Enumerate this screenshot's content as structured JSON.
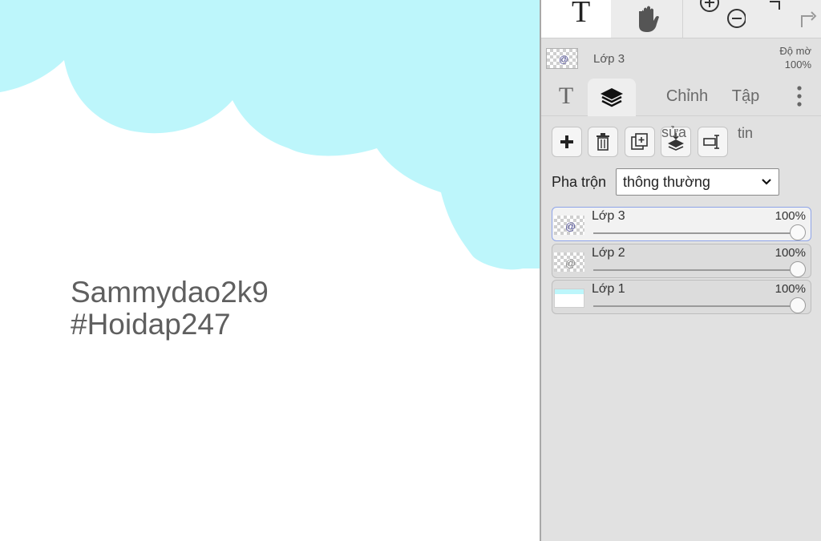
{
  "canvas": {
    "text_line1": "Sammydao2k9",
    "text_line2": "#Hoidap247",
    "cloud_color": "#bdf6fb",
    "text_color": "#5f5f5f"
  },
  "toolbar": {
    "tools": [
      {
        "name": "text-tool",
        "icon": "text-T-icon"
      },
      {
        "name": "hand-tool",
        "icon": "hand-icon"
      },
      {
        "name": "zoom-tool",
        "icon": "zoom-in-out-icon"
      },
      {
        "name": "undo-redo",
        "icon": "redo-icon"
      }
    ]
  },
  "layer_header": {
    "name": "Lớp 3",
    "opacity_label": "Độ mờ",
    "opacity_value": "100%"
  },
  "tabs": {
    "text_icon": "T",
    "layers_icon": "layers-icon",
    "adjust": "Chỉnh",
    "collection": "Tập",
    "more_icon": "more-vertical-icon"
  },
  "actions": {
    "overflow_left": "sửa",
    "overflow_right": "tin",
    "buttons": [
      "add-icon",
      "trash-icon",
      "duplicate-icon",
      "merge-down-icon",
      "rename-icon"
    ]
  },
  "blend": {
    "label": "Pha trộn",
    "value": "thông thường"
  },
  "layers": [
    {
      "name": "Lớp 3",
      "opacity": "100%",
      "active": true
    },
    {
      "name": "Lớp 2",
      "opacity": "100%",
      "active": false
    },
    {
      "name": "Lớp 1",
      "opacity": "100%",
      "active": false
    }
  ],
  "colors": {
    "panel_bg": "#e1e1e1",
    "active_row_border": "#8ea4e8"
  }
}
